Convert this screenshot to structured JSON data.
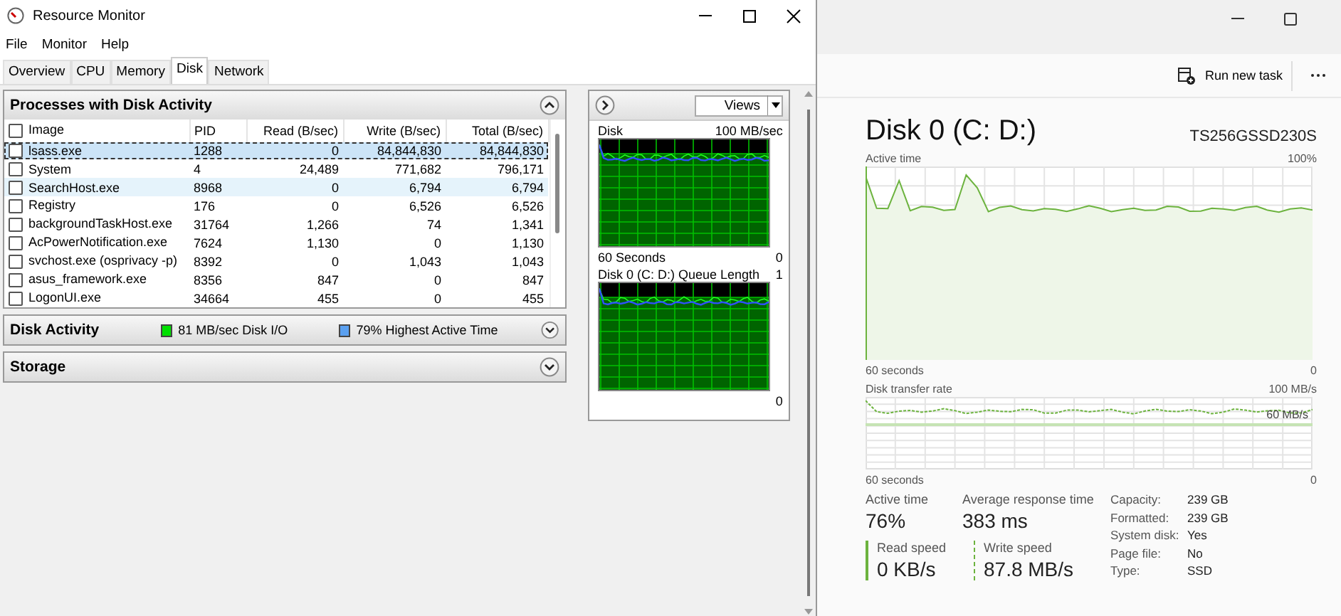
{
  "resource_monitor": {
    "title": "Resource Monitor",
    "menu": [
      "File",
      "Monitor",
      "Help"
    ],
    "tabs": [
      {
        "label": "Overview",
        "selected": false
      },
      {
        "label": "CPU",
        "selected": false
      },
      {
        "label": "Memory",
        "selected": false
      },
      {
        "label": "Disk",
        "selected": true
      },
      {
        "label": "Network",
        "selected": false
      }
    ],
    "processes": {
      "title": "Processes with Disk Activity",
      "expanded": true,
      "columns": [
        "Image",
        "PID",
        "Read (B/sec)",
        "Write (B/sec)",
        "Total (B/sec)"
      ],
      "all_checked": false,
      "rows": [
        {
          "cells": [
            "lsass.exe",
            "1288",
            "0",
            "84,844,830",
            "84,844,830"
          ],
          "checked": false,
          "selected": true,
          "highlighted": false
        },
        {
          "cells": [
            "System",
            "4",
            "24,489",
            "771,682",
            "796,171"
          ],
          "checked": false,
          "selected": false,
          "highlighted": false
        },
        {
          "cells": [
            "SearchHost.exe",
            "8968",
            "0",
            "6,794",
            "6,794"
          ],
          "checked": false,
          "selected": false,
          "highlighted": true
        },
        {
          "cells": [
            "Registry",
            "176",
            "0",
            "6,526",
            "6,526"
          ],
          "checked": false,
          "selected": false,
          "highlighted": false
        },
        {
          "cells": [
            "backgroundTaskHost.exe",
            "31764",
            "1,266",
            "74",
            "1,341"
          ],
          "checked": false,
          "selected": false,
          "highlighted": false
        },
        {
          "cells": [
            "AcPowerNotification.exe",
            "7624",
            "1,130",
            "0",
            "1,130"
          ],
          "checked": false,
          "selected": false,
          "highlighted": false
        },
        {
          "cells": [
            "svchost.exe (osprivacy -p)",
            "8392",
            "0",
            "1,043",
            "1,043"
          ],
          "checked": false,
          "selected": false,
          "highlighted": false
        },
        {
          "cells": [
            "asus_framework.exe",
            "8356",
            "847",
            "0",
            "847"
          ],
          "checked": false,
          "selected": false,
          "highlighted": false
        },
        {
          "cells": [
            "LogonUI.exe",
            "34664",
            "455",
            "0",
            "455"
          ],
          "checked": false,
          "selected": false,
          "highlighted": false
        }
      ]
    },
    "disk_activity": {
      "title": "Disk Activity",
      "expanded": false,
      "legend": [
        {
          "label": "81 MB/sec Disk I/O",
          "color": "#00e000"
        },
        {
          "label": "79% Highest Active Time",
          "color": "#5aa0f0"
        }
      ]
    },
    "storage": {
      "title": "Storage",
      "expanded": false
    },
    "graph_pane": {
      "views_button": "Views",
      "graphs": [
        {
          "title": "Disk",
          "max_label": "100 MB/sec",
          "time_label": "60 Seconds",
          "min_label": "0"
        },
        {
          "title": "Disk 0 (C: D:) Queue Length",
          "max_label": "1",
          "min_label": "0"
        }
      ]
    }
  },
  "task_manager": {
    "run_new_task": "Run new task",
    "disk_title": "Disk 0 (C: D:)",
    "model": "TS256GSSD230S",
    "active_time_chart": {
      "label": "Active time",
      "max_label": "100%",
      "time_label": "60 seconds",
      "min_label": "0"
    },
    "transfer_chart": {
      "label": "Disk transfer rate",
      "max_label": "100 MB/s",
      "scale_label": "60 MB/s",
      "time_label": "60 seconds",
      "min_label": "0"
    },
    "stats": [
      {
        "label": "Active time",
        "value": "76%"
      },
      {
        "label": "Average response time",
        "value": "383 ms"
      }
    ],
    "speeds": [
      {
        "label": "Read speed",
        "value": "0 KB/s",
        "kind": "solid"
      },
      {
        "label": "Write speed",
        "value": "87.8 MB/s",
        "kind": "dashed"
      }
    ],
    "properties": [
      {
        "label": "Capacity:",
        "value": "239 GB"
      },
      {
        "label": "Formatted:",
        "value": "239 GB"
      },
      {
        "label": "System disk:",
        "value": "Yes"
      },
      {
        "label": "Page file:",
        "value": "No"
      },
      {
        "label": "Type:",
        "value": "SSD"
      }
    ]
  }
}
